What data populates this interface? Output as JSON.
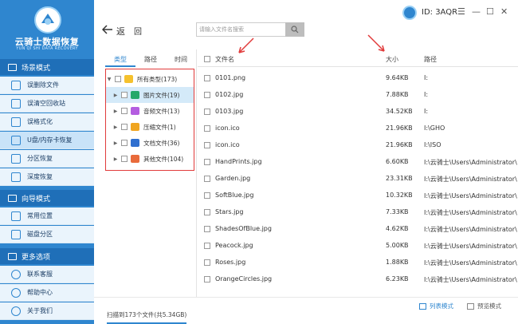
{
  "app": {
    "title": "云骑士数据恢复",
    "subtitle": "YUN QI SHI DATA RECOVERY",
    "user_id": "ID: 3AQR"
  },
  "sidebar": {
    "sections": [
      {
        "label": "场景模式",
        "items": [
          "误删除文件",
          "误清空回收站",
          "误格式化",
          "U盘/内存卡恢复",
          "分区恢复",
          "深度恢复"
        ]
      },
      {
        "label": "向导模式",
        "items": [
          "常用位置",
          "磁盘分区"
        ]
      },
      {
        "label": "更多选项",
        "items": [
          "联系客服",
          "帮助中心",
          "关于我们"
        ]
      }
    ],
    "active_item": "U盘/内存卡恢复"
  },
  "header": {
    "back_label": "返",
    "home_label": "回",
    "search_placeholder": "请输入文件名搜索",
    "window_controls": [
      "—",
      "☐",
      "✕"
    ],
    "menu_glyph": "☰"
  },
  "type_panel": {
    "tabs": [
      "类型",
      "路径",
      "时间"
    ],
    "tree": [
      {
        "label": "所有类型(173)",
        "icon": "folder-icon",
        "color": "#f5c12d"
      },
      {
        "label": "图片文件(19)",
        "icon": "image-icon",
        "color": "#25a86b"
      },
      {
        "label": "音频文件(13)",
        "icon": "audio-icon",
        "color": "#b45de0"
      },
      {
        "label": "压缩文件(1)",
        "icon": "zip-icon",
        "color": "#f0a520"
      },
      {
        "label": "文档文件(36)",
        "icon": "doc-icon",
        "color": "#2f6fcf"
      },
      {
        "label": "其他文件(104)",
        "icon": "other-icon",
        "color": "#e96b3b"
      }
    ]
  },
  "table": {
    "headers": {
      "name": "文件名",
      "size": "大小",
      "path": "路径"
    },
    "rows": [
      {
        "name": "0101.png",
        "size": "9.64KB",
        "path": "I:"
      },
      {
        "name": "0102.jpg",
        "size": "7.88KB",
        "path": "I:"
      },
      {
        "name": "0103.jpg",
        "size": "34.52KB",
        "path": "I:"
      },
      {
        "name": "icon.ico",
        "size": "21.96KB",
        "path": "I:\\GHO"
      },
      {
        "name": "icon.ico",
        "size": "21.96KB",
        "path": "I:\\ISO"
      },
      {
        "name": "HandPrints.jpg",
        "size": "6.60KB",
        "path": "I:\\云骑士\\Users\\Administrator\\"
      },
      {
        "name": "Garden.jpg",
        "size": "23.31KB",
        "path": "I:\\云骑士\\Users\\Administrator\\"
      },
      {
        "name": "SoftBlue.jpg",
        "size": "10.32KB",
        "path": "I:\\云骑士\\Users\\Administrator\\"
      },
      {
        "name": "Stars.jpg",
        "size": "7.33KB",
        "path": "I:\\云骑士\\Users\\Administrator\\"
      },
      {
        "name": "ShadesOfBlue.jpg",
        "size": "4.62KB",
        "path": "I:\\云骑士\\Users\\Administrator\\"
      },
      {
        "name": "Peacock.jpg",
        "size": "5.00KB",
        "path": "I:\\云骑士\\Users\\Administrator\\"
      },
      {
        "name": "Roses.jpg",
        "size": "1.88KB",
        "path": "I:\\云骑士\\Users\\Administrator\\"
      },
      {
        "name": "OrangeCircles.jpg",
        "size": "6.23KB",
        "path": "I:\\云骑士\\Users\\Administrator\\"
      }
    ]
  },
  "footer": {
    "status": "扫描到173个文件(共5.34GB)",
    "list_mode": "列表模式",
    "preview_mode": "预览模式"
  },
  "colors": {
    "brand": "#2f86cf",
    "annotation": "#e13b3b"
  }
}
